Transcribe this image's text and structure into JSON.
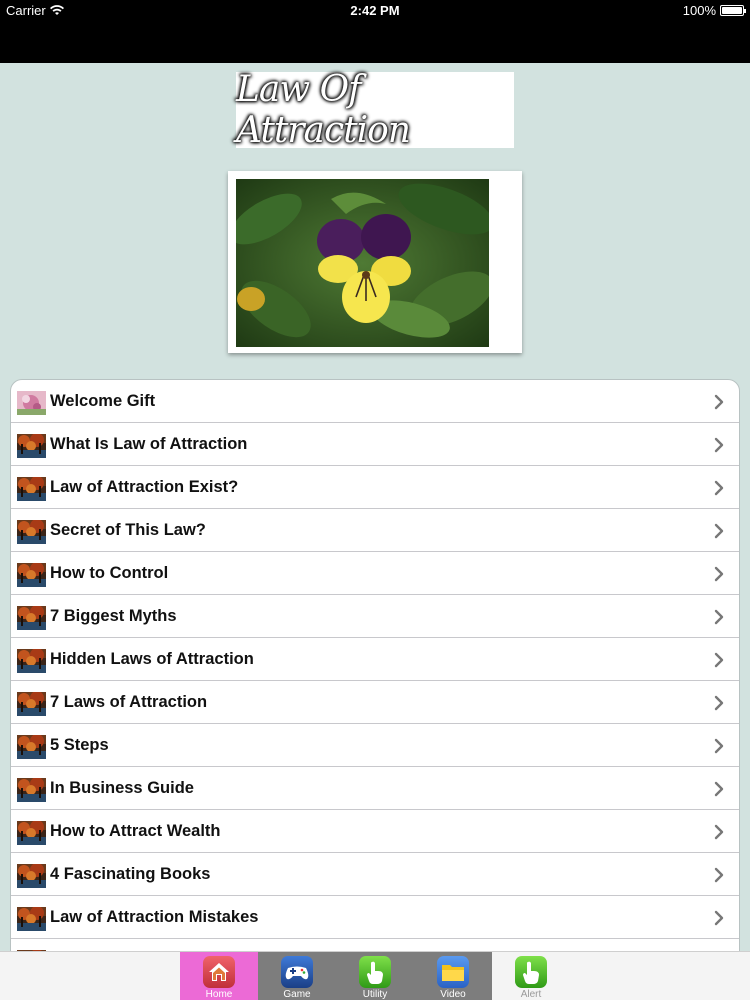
{
  "status_bar": {
    "carrier": "Carrier",
    "time": "2:42 PM",
    "battery": "100%",
    "battery_level": 1.0
  },
  "header": {
    "logo_text": "Law Of Attraction"
  },
  "menu": {
    "items": [
      {
        "label": "Welcome Gift",
        "thumb": "gift-thumb"
      },
      {
        "label": "What Is Law of Attraction",
        "thumb": "autumn-thumb"
      },
      {
        "label": "Law of Attraction Exist?",
        "thumb": "autumn-thumb"
      },
      {
        "label": "Secret of This Law?",
        "thumb": "autumn-thumb"
      },
      {
        "label": "How to Control",
        "thumb": "autumn-thumb"
      },
      {
        "label": "7 Biggest Myths",
        "thumb": "autumn-thumb"
      },
      {
        "label": "Hidden Laws of Attraction",
        "thumb": "autumn-thumb"
      },
      {
        "label": "7 Laws of Attraction",
        "thumb": "autumn-thumb"
      },
      {
        "label": "5 Steps",
        "thumb": "autumn-thumb"
      },
      {
        "label": "In Business Guide",
        "thumb": "autumn-thumb"
      },
      {
        "label": "How to Attract Wealth",
        "thumb": "autumn-thumb"
      },
      {
        "label": "4 Fascinating Books",
        "thumb": "autumn-thumb"
      },
      {
        "label": "Law of Attraction Mistakes",
        "thumb": "autumn-thumb"
      },
      {
        "label": "",
        "thumb": "autumn-thumb"
      }
    ]
  },
  "tab_bar": {
    "tabs": [
      {
        "label": "Home",
        "icon": "home-icon",
        "selected": true
      },
      {
        "label": "Game",
        "icon": "gamepad-icon",
        "selected": false
      },
      {
        "label": "Utility",
        "icon": "hand-pointer-icon",
        "selected": false
      },
      {
        "label": "Video",
        "icon": "folder-icon",
        "selected": false
      },
      {
        "label": "Alert",
        "icon": "hand-pointer-icon",
        "selected": false
      }
    ]
  },
  "colors": {
    "content_bg": "#d2e2df",
    "tab_selected_bg": "#ec6ad6",
    "tab_group_bg": "#7d7d7d",
    "tab_alert_label": "#9a9a9a"
  }
}
